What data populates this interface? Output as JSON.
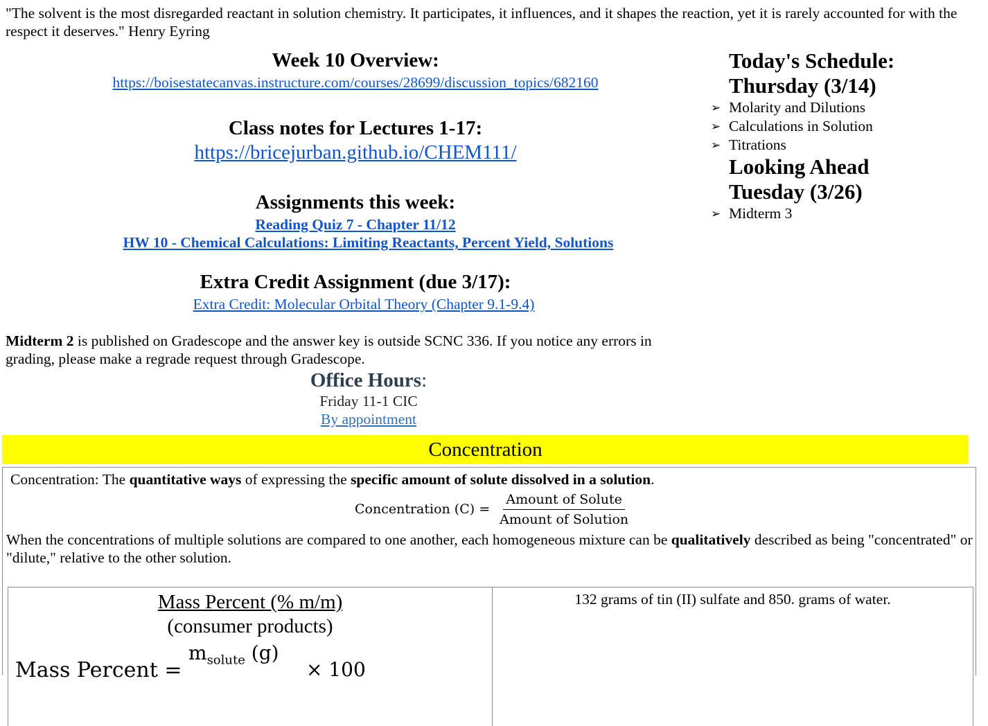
{
  "quote": {
    "text": "\"The solvent is the most disregarded reactant in solution chemistry. It participates, it influences, and it shapes the reaction, yet it is rarely accounted for with the respect it deserves.\" Henry Eyring"
  },
  "week_overview": {
    "title": "Week 10 Overview:",
    "link": "https://boisestatecanvas.instructure.com/courses/28699/discussion_topics/682160"
  },
  "class_notes": {
    "title": "Class notes for Lectures 1-17:",
    "link": "https://bricejurban.github.io/CHEM111/"
  },
  "assignments": {
    "title": "Assignments this week:",
    "items": [
      "Reading Quiz 7 - Chapter 11/12",
      "HW 10 - Chemical Calculations: Limiting Reactants, Percent Yield, Solutions"
    ]
  },
  "extra_credit": {
    "title": "Extra Credit Assignment (due 3/17):",
    "link": "Extra Credit: Molecular Orbital Theory (Chapter 9.1-9.4)"
  },
  "midterm_note": {
    "bold": "Midterm 2",
    "text": " is published on Gradescope and the answer key is outside SCNC 336. If you notice any errors in grading, please make a regrade request through Gradescope."
  },
  "office_hours": {
    "title": "Office Hours",
    "colon": ":",
    "line1": "Friday 11-1 CIC",
    "link": "By appointment"
  },
  "schedule": {
    "today_heading": "Today's Schedule:",
    "today_date": "Thursday (3/14)",
    "today_items": [
      "Molarity and Dilutions",
      "Calculations in Solution",
      "Titrations"
    ],
    "ahead_heading": "Looking Ahead",
    "ahead_date": "Tuesday (3/26)",
    "ahead_items": [
      "Midterm 3"
    ],
    "bullet_icon": "arrowhead-bullet"
  },
  "concentration": {
    "banner": "Concentration",
    "banner_color": "#ffff00",
    "definition": {
      "prefix": "Concentration: The ",
      "bold1": "quantitative ways",
      "mid": " of expressing the ",
      "bold2": "specific amount of solute dissolved in a solution",
      "suffix": "."
    },
    "formula": {
      "lhs": "Concentration (C) =",
      "numerator": "Amount of Solute",
      "denominator": "Amount of Solution"
    },
    "comparison": {
      "prefix": "When the concentrations of multiple solutions are compared to one another, each homogeneous mixture can be ",
      "bold": "qualitatively",
      "suffix": " described as being \"concentrated\" or \"dilute,\" relative to the other solution."
    },
    "table": {
      "mass_percent_title": "Mass Percent (% m/m)",
      "mass_percent_sub": "(consumer products)",
      "formula_lhs": "Mass Percent =",
      "formula_num_main": "m",
      "formula_num_sub": "solute",
      "formula_num_unit": " (g)",
      "formula_times": "× 100",
      "example": "132 grams of tin (II) sulfate and 850. grams of water."
    }
  },
  "colors": {
    "link": "#1155cc",
    "office_title": "#2c3e50"
  }
}
